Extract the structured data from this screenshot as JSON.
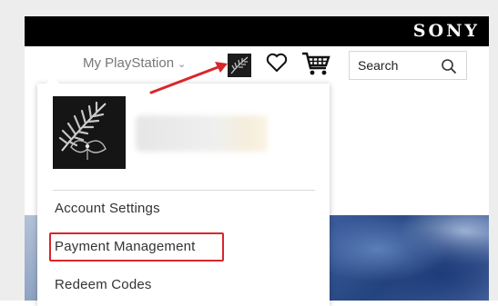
{
  "brand": {
    "logo_text": "SONY"
  },
  "nav": {
    "my_playstation_label": "My PlayStation",
    "chevron_icon": "chevron-down-icon",
    "avatar_icon": "avatar-thumbnail",
    "wishlist_icon": "heart-icon",
    "cart_icon": "shopping-cart-icon",
    "search_label": "Search",
    "search_icon": "search-icon"
  },
  "dropdown": {
    "items": [
      {
        "label": "Account Settings"
      },
      {
        "label": "Payment Management"
      },
      {
        "label": "Redeem Codes"
      }
    ]
  },
  "colors": {
    "topbar": "#000000",
    "highlight": "#d9262a",
    "arrow": "#d9262a",
    "banner": "#2f4f8f"
  }
}
